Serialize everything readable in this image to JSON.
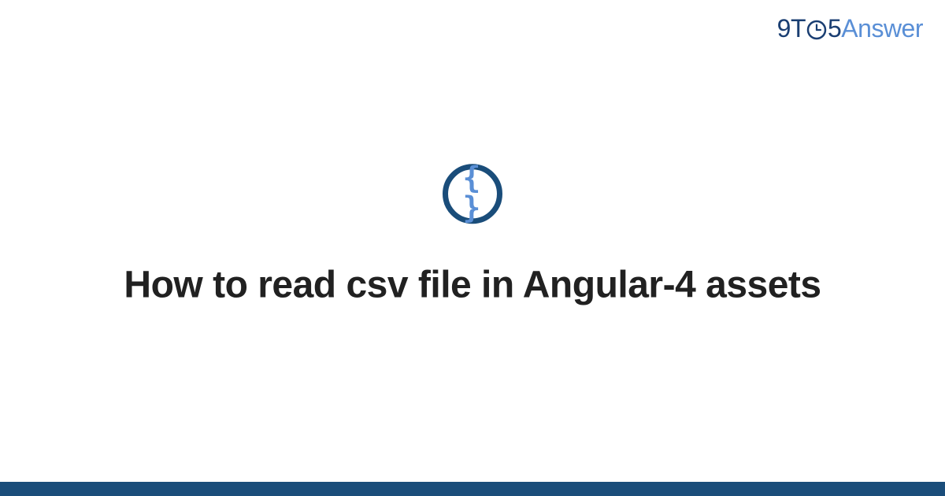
{
  "brand": {
    "prefix": "9T",
    "middle": "5",
    "suffix": "Answer"
  },
  "badge": {
    "icon_name": "code-braces-icon",
    "glyph": "{ }"
  },
  "title": "How to read csv file in Angular-4 assets",
  "colors": {
    "dark_blue": "#1a4d7a",
    "light_blue": "#5a8fd6",
    "brand_dark": "#1a3e72"
  }
}
